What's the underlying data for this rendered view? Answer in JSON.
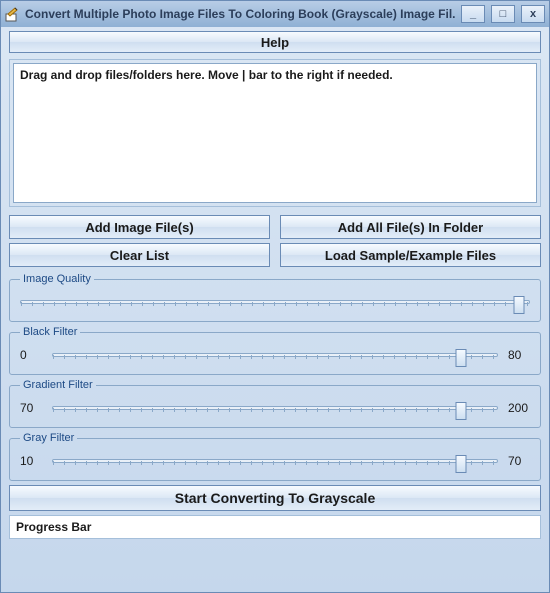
{
  "window": {
    "title": "Convert Multiple Photo Image Files To Coloring Book (Grayscale) Image Fil..."
  },
  "help": {
    "label": "Help"
  },
  "drop_hint": "Drag and drop files/folders here. Move | bar to the right if needed.",
  "buttons": {
    "add_files": "Add Image File(s)",
    "add_folder": "Add All File(s) In Folder",
    "clear": "Clear List",
    "load_sample": "Load Sample/Example Files",
    "start": "Start Converting To Grayscale"
  },
  "sliders": {
    "image_quality": {
      "label": "Image Quality",
      "left": "",
      "right": "",
      "pos": 98
    },
    "black_filter": {
      "label": "Black Filter",
      "left": "0",
      "right": "80",
      "pos": 92
    },
    "gradient_filter": {
      "label": "Gradient Filter",
      "left": "70",
      "right": "200",
      "pos": 92
    },
    "gray_filter": {
      "label": "Gray Filter",
      "left": "10",
      "right": "70",
      "pos": 92
    }
  },
  "progress": {
    "label": "Progress Bar"
  }
}
